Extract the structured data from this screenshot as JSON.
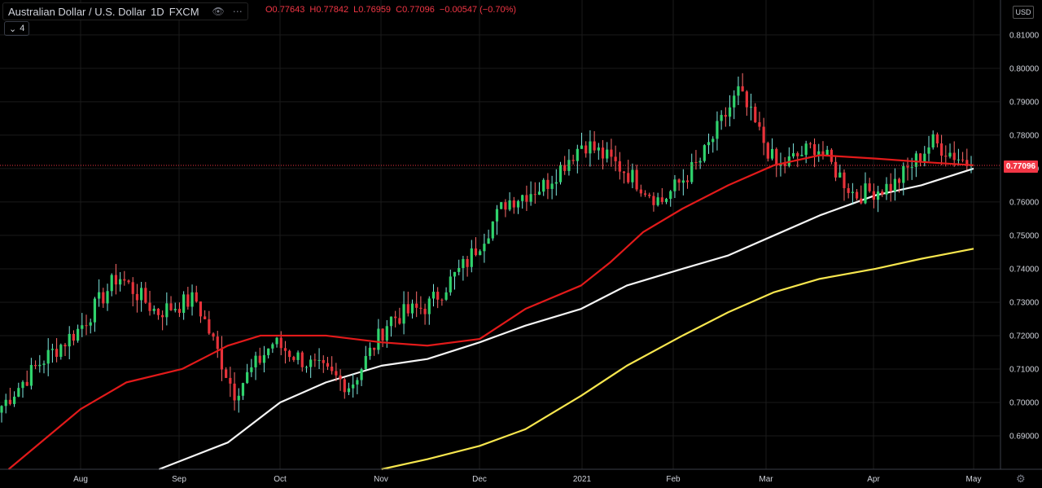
{
  "header": {
    "symbol_title": "Australian Dollar / U.S. Dollar",
    "interval": "1D",
    "exchange": "FXCM",
    "open_label": "O0.77643",
    "high_label": "H0.77842",
    "low_label": "L0.76959",
    "close_label": "C0.77096",
    "change_label": "−0.00547 (−0.70%)",
    "indicator_count": "4",
    "currency": "USD",
    "last_price_label": "0.77096"
  },
  "colors": {
    "up": "#26a69a",
    "up_wick": "#7ee8e0",
    "up_body": "#2fd36c",
    "down_body": "#e8323a",
    "ma_fast": "#e21a1a",
    "ma_mid": "#f5f5f5",
    "ma_slow": "#f7e64e",
    "grid": "#1a1a1a"
  },
  "chart_data": {
    "type": "candlestick",
    "title": "Australian Dollar / U.S. Dollar",
    "interval": "1D",
    "ylim": [
      0.68,
      0.82
    ],
    "y_ticks": [
      "0.69000",
      "0.70000",
      "0.71000",
      "0.72000",
      "0.73000",
      "0.74000",
      "0.75000",
      "0.76000",
      "0.77000",
      "0.78000",
      "0.79000",
      "0.80000",
      "0.81000"
    ],
    "x_labels": [
      "Aug",
      "Sep",
      "Oct",
      "Nov",
      "Dec",
      "2021",
      "Feb",
      "Mar",
      "Apr",
      "May"
    ],
    "last_price": 0.77096,
    "anchors": [
      [
        "Aug",
        0.699
      ],
      [
        "Aug",
        0.712
      ],
      [
        "Aug",
        0.722
      ],
      [
        "Sep",
        0.738
      ],
      [
        "Sep",
        0.727
      ],
      [
        "Sep",
        0.731
      ],
      [
        "Oct",
        0.703
      ],
      [
        "Oct",
        0.718
      ],
      [
        "Oct",
        0.711
      ],
      [
        "Nov",
        0.705
      ],
      [
        "Nov",
        0.725
      ],
      [
        "Nov",
        0.729
      ],
      [
        "Dec",
        0.742
      ],
      [
        "Dec",
        0.76
      ],
      [
        "Dec",
        0.765
      ],
      [
        "2021",
        0.778
      ],
      [
        "2021",
        0.77
      ],
      [
        "Feb",
        0.76
      ],
      [
        "Feb",
        0.772
      ],
      [
        "Feb",
        0.793
      ],
      [
        "Mar",
        0.77
      ],
      [
        "Mar",
        0.777
      ],
      [
        "Mar",
        0.762
      ],
      [
        "Apr",
        0.765
      ],
      [
        "Apr",
        0.778
      ],
      [
        "May",
        0.771
      ]
    ],
    "series": [
      {
        "key": "ma_fast",
        "points": [
          [
            "2020-07-10",
            0.68
          ],
          [
            "2020-08-01",
            0.698
          ],
          [
            "2020-08-15",
            0.706
          ],
          [
            "2020-09-01",
            0.71
          ],
          [
            "2020-09-15",
            0.717
          ],
          [
            "2020-09-25",
            0.72
          ],
          [
            "2020-10-15",
            0.72
          ],
          [
            "2020-11-01",
            0.718
          ],
          [
            "2020-11-15",
            0.717
          ],
          [
            "2020-12-01",
            0.719
          ],
          [
            "2020-12-15",
            0.728
          ],
          [
            "2021-01-01",
            0.735
          ],
          [
            "2021-01-10",
            0.742
          ],
          [
            "2021-01-20",
            0.751
          ],
          [
            "2021-02-01",
            0.758
          ],
          [
            "2021-02-15",
            0.765
          ],
          [
            "2021-03-01",
            0.771
          ],
          [
            "2021-03-15",
            0.774
          ],
          [
            "2021-04-01",
            0.773
          ],
          [
            "2021-04-15",
            0.772
          ],
          [
            "2021-05-01",
            0.771
          ]
        ]
      },
      {
        "key": "ma_mid",
        "points": [
          [
            "2020-08-25",
            0.68
          ],
          [
            "2020-09-15",
            0.688
          ],
          [
            "2020-10-01",
            0.7
          ],
          [
            "2020-10-15",
            0.706
          ],
          [
            "2020-11-01",
            0.711
          ],
          [
            "2020-11-15",
            0.713
          ],
          [
            "2020-12-01",
            0.718
          ],
          [
            "2020-12-15",
            0.723
          ],
          [
            "2021-01-01",
            0.728
          ],
          [
            "2021-01-15",
            0.735
          ],
          [
            "2021-02-01",
            0.74
          ],
          [
            "2021-02-15",
            0.744
          ],
          [
            "2021-03-01",
            0.75
          ],
          [
            "2021-03-15",
            0.756
          ],
          [
            "2021-04-01",
            0.762
          ],
          [
            "2021-04-15",
            0.765
          ],
          [
            "2021-05-01",
            0.77
          ]
        ]
      },
      {
        "key": "ma_slow",
        "points": [
          [
            "2020-11-01",
            0.68
          ],
          [
            "2020-11-15",
            0.683
          ],
          [
            "2020-12-01",
            0.687
          ],
          [
            "2020-12-15",
            0.692
          ],
          [
            "2021-01-01",
            0.702
          ],
          [
            "2021-01-15",
            0.711
          ],
          [
            "2021-02-01",
            0.72
          ],
          [
            "2021-02-15",
            0.727
          ],
          [
            "2021-03-01",
            0.733
          ],
          [
            "2021-03-15",
            0.737
          ],
          [
            "2021-04-01",
            0.74
          ],
          [
            "2021-04-15",
            0.743
          ],
          [
            "2021-05-01",
            0.746
          ]
        ]
      }
    ]
  }
}
